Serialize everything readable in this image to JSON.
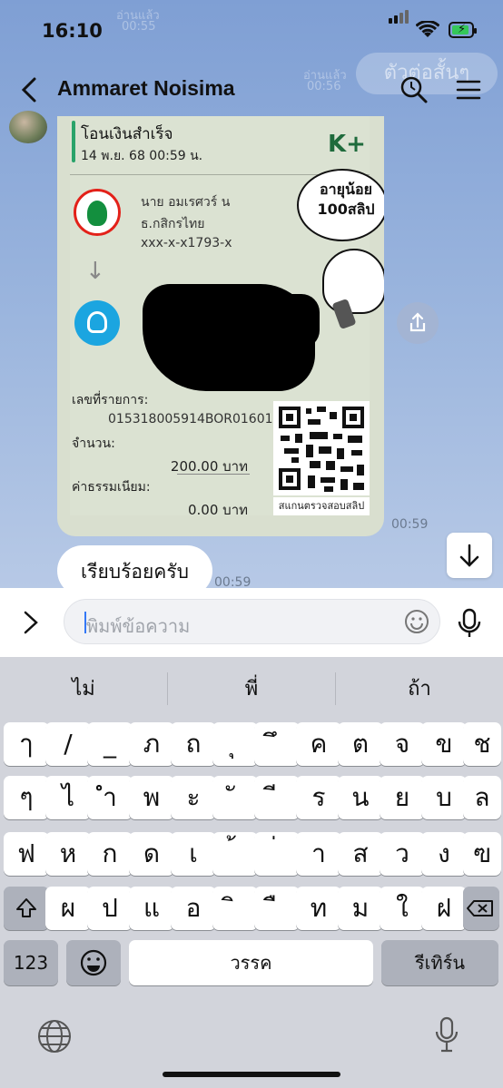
{
  "status_bar": {
    "time": "16:10"
  },
  "header": {
    "title": "Ammaret Noisima"
  },
  "background_ghost": {
    "a": "อ่านแล้ว",
    "b": "00:55",
    "c": "อ่านแล้ว",
    "d": "00:56",
    "pill": "ตัวต่อสั้นๆ"
  },
  "slip": {
    "title": "โอนเงินสำเร็จ",
    "date": "14 พ.ย. 68  00:59 น.",
    "brand": "K+",
    "sender_name": "นาย อมเรศวร์ น",
    "sender_bank": "ธ.กสิกรไทย",
    "sender_account": "xxx-x-x1793-x",
    "speech_text": "อายุน้อย 100สลิป",
    "ref_label": "เลขที่รายการ:",
    "ref_value": "015318005914BOR01601",
    "amount_label": "จำนวน:",
    "amount_value": "200.00 บาท",
    "fee_label": "ค่าธรรมเนียม:",
    "fee_value": "0.00 บาท",
    "qr_caption": "สแกนตรวจสอบสลิป"
  },
  "messages": [
    {
      "type": "image",
      "time": "00:59"
    },
    {
      "type": "text",
      "text": "เรียบร้อยครับ",
      "time": "00:59"
    }
  ],
  "composer": {
    "placeholder": "พิมพ์ข้อความ"
  },
  "keyboard": {
    "suggestions": [
      "ไม่",
      "พี่",
      "ถ้า"
    ],
    "row1": [
      "ๅ",
      "/",
      "_",
      "ภ",
      "ถ",
      "ุ",
      "ึ",
      "ค",
      "ต",
      "จ",
      "ข",
      "ช"
    ],
    "row2": [
      "ๆ",
      "ไ",
      "ำ",
      "พ",
      "ะ",
      "ั",
      "ี",
      "ร",
      "น",
      "ย",
      "บ",
      "ล"
    ],
    "row3": [
      "ฟ",
      "ห",
      "ก",
      "ด",
      "เ",
      "้",
      "่",
      "า",
      "ส",
      "ว",
      "ง",
      "ฃ"
    ],
    "row4": [
      "ผ",
      "ป",
      "แ",
      "อ",
      "ิ",
      "ื",
      "ท",
      "ม",
      "ใ",
      "ฝ"
    ],
    "shift_icon": "shift-icon",
    "delete_icon": "delete-icon",
    "numbers_label": "123",
    "space_label": "วรรค",
    "return_label": "รีเทิร์น"
  },
  "colors": {
    "kbank_green": "#138f3e",
    "ktb_blue": "#1ba5e0",
    "accent_bar": "#2aa36a"
  }
}
